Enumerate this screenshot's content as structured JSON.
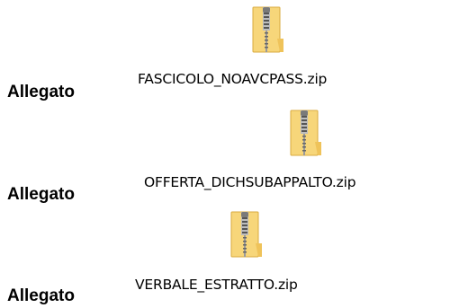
{
  "attachments": [
    {
      "label": "Allegato",
      "file_name": "FASCICOLO_NOAVCPASS.zip",
      "icon": "zip-archive-icon"
    },
    {
      "label": "Allegato",
      "file_name": "OFFERTA_DICHSUBAPPALTO.zip",
      "icon": "zip-archive-icon"
    },
    {
      "label": "Allegato",
      "file_name": "VERBALE_ESTRATTO.zip",
      "icon": "zip-archive-icon"
    }
  ],
  "colors": {
    "folder_body": "#f7d67a",
    "folder_dark": "#e5b64c",
    "zipper": "#8a8a8a"
  }
}
